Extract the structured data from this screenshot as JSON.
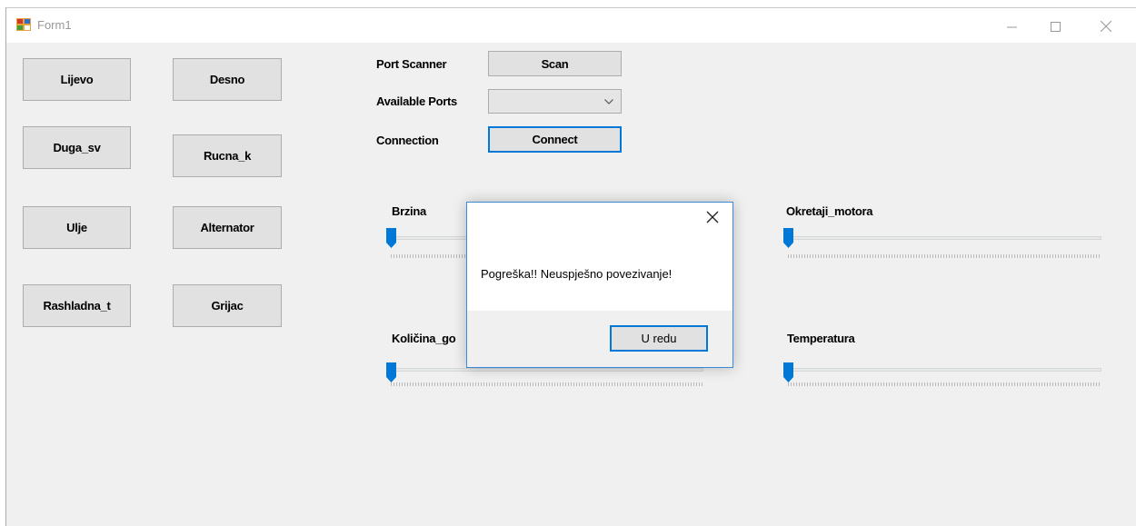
{
  "window": {
    "title": "Form1",
    "minimize_icon": "minimize-icon",
    "maximize_icon": "maximize-icon",
    "close_icon": "close-icon"
  },
  "buttons": {
    "lijevo": "Lijevo",
    "desno": "Desno",
    "duga_sv": "Duga_sv",
    "rucna_k": "Rucna_k",
    "ulje": "Ulje",
    "alternator": "Alternator",
    "rashladna_t": "Rashladna_t",
    "grijac": "Grijac"
  },
  "port": {
    "scanner_label": "Port Scanner",
    "scan_button": "Scan",
    "available_label": "Available Ports",
    "selected_port": "",
    "connection_label": "Connection",
    "connect_button": "Connect"
  },
  "sliders": {
    "brzina": {
      "label": "Brzina",
      "value": 0
    },
    "okretaji": {
      "label": "Okretaji_motora",
      "value": 0
    },
    "kolicina": {
      "label": "Količina_go",
      "value": 0
    },
    "temperatura": {
      "label": "Temperatura",
      "value": 0
    }
  },
  "dialog": {
    "message": "Pogreška!! Neuspješno povezivanje!",
    "ok_button": "U redu",
    "accent": "#0078d7"
  }
}
